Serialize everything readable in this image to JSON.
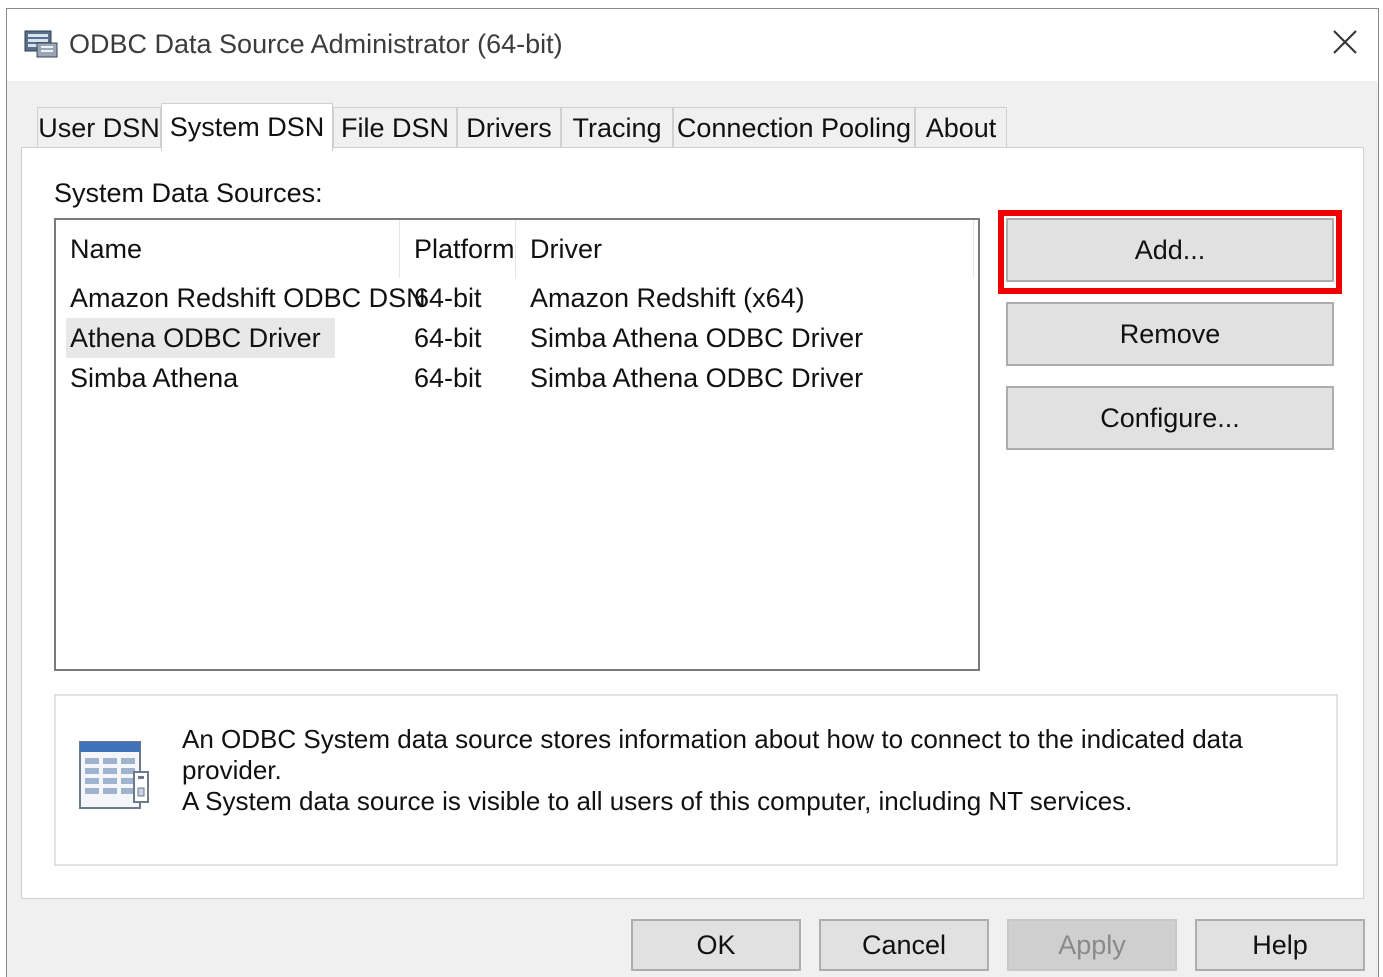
{
  "window": {
    "title": "ODBC Data Source Administrator (64-bit)",
    "close_icon": "close-icon",
    "app_icon": "odbc-admin-icon"
  },
  "tabs": [
    {
      "label": "User DSN",
      "active": false
    },
    {
      "label": "System DSN",
      "active": true
    },
    {
      "label": "File DSN",
      "active": false
    },
    {
      "label": "Drivers",
      "active": false
    },
    {
      "label": "Tracing",
      "active": false
    },
    {
      "label": "Connection Pooling",
      "active": false
    },
    {
      "label": "About",
      "active": false
    }
  ],
  "panel": {
    "section_label": "System Data Sources:",
    "columns": [
      "Name",
      "Platform",
      "Driver"
    ],
    "rows": [
      {
        "name": "Amazon Redshift ODBC DSN",
        "platform": "64-bit",
        "driver": "Amazon Redshift (x64)"
      },
      {
        "name": "Athena ODBC Driver",
        "platform": "64-bit",
        "driver": "Simba Athena ODBC Driver"
      },
      {
        "name": "Simba Athena",
        "platform": "64-bit",
        "driver": "Simba Athena ODBC Driver"
      }
    ],
    "buttons": {
      "add": "Add...",
      "remove": "Remove",
      "configure": "Configure..."
    },
    "info": {
      "icon": "data-source-icon",
      "line1": "An ODBC System data source stores information about how to connect to the indicated data provider.",
      "line2": "A System data source is visible to all users of this computer, including NT services."
    }
  },
  "footer": {
    "ok": "OK",
    "cancel": "Cancel",
    "apply": "Apply",
    "help": "Help"
  },
  "colors": {
    "highlight_ring": "#ee0000",
    "window_bg": "#f0f0f0",
    "button_bg": "#e1e1e1"
  }
}
